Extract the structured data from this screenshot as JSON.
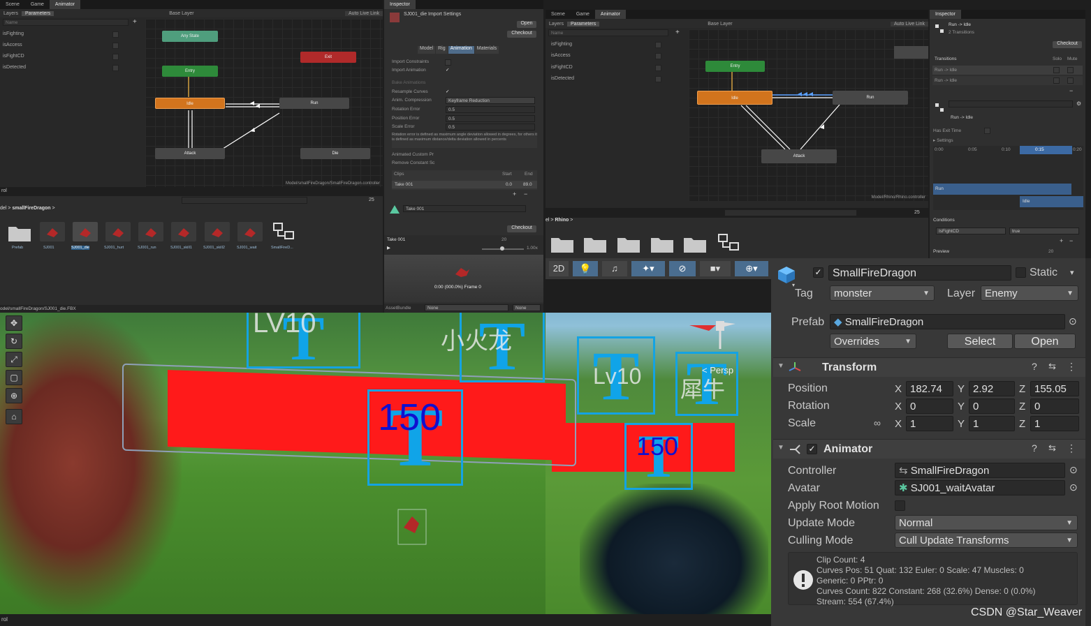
{
  "left_animator": {
    "tabs": [
      "Scene",
      "Game",
      "Animator"
    ],
    "subtabs": [
      "Layers",
      "Parameters"
    ],
    "layer_title": "Base Layer",
    "auto_live_link": "Auto Live Link",
    "search_placeholder": "Name",
    "params": [
      "isFighting",
      "isAccess",
      "isFightCD",
      "isDetected"
    ],
    "states": {
      "any": "Any State",
      "exit": "Exit",
      "entry": "Entry",
      "idle": "Idle",
      "run": "Run",
      "attack": "Attack",
      "die": "Die"
    },
    "controller_path": "Model/smallFireDragon/SmallFireDragon.controller"
  },
  "project": {
    "panel_label": "rol",
    "breadcrumb_prefix": "del",
    "breadcrumb": "smallFireDragon",
    "count": "25",
    "assets": [
      "Prefab",
      "SJ001",
      "SJ001_die",
      "SJ001_hurt",
      "SJ001_run",
      "SJ001_skill1",
      "SJ001_skill2",
      "SJ001_wait",
      "SmallFireD..."
    ],
    "status_path": "odel/smallFireDragon/SJ001_die.FBX"
  },
  "import_inspector": {
    "tab": "Inspector",
    "title": "SJ001_die Import Settings",
    "open_label": "Open",
    "checkout_label": "Checkout",
    "tabs": [
      "Model",
      "Rig",
      "Animation",
      "Materials"
    ],
    "rows": [
      {
        "label": "Import Constraints",
        "value": ""
      },
      {
        "label": "Import Animation",
        "value": "✓"
      },
      {
        "label": "Bake Animations",
        "value": ""
      },
      {
        "label": "Resample Curves",
        "value": "✓"
      },
      {
        "label": "Anim. Compression",
        "value": "Keyframe Reduction"
      },
      {
        "label": "Rotation Error",
        "value": "0.5"
      },
      {
        "label": "Position Error",
        "value": "0.5"
      },
      {
        "label": "Scale Error",
        "value": "0.5"
      }
    ],
    "note": "Rotation error is defined as maximum angle deviation allowed in degrees, for others it is defined as maximum distance/delta deviation allowed in percents",
    "rows2": [
      "Animated Custom Pr",
      "Remove Constant Sc"
    ],
    "clips_header": {
      "name": "Clips",
      "start": "Start",
      "end": "End"
    },
    "clip": {
      "name": "Take 001",
      "start": "0.0",
      "end": "89.0"
    },
    "take_name": "Take 001",
    "checkout2": "Checkout",
    "preview_name": "Take 001",
    "preview_frames": "20",
    "preview_speed": "1.00x",
    "preview_time": "0:00 (000.0%) Frame 0",
    "asset_bundle_label": "AssetBundle",
    "asset_bundle_value": "None",
    "asset_bundle_variant": "None"
  },
  "right_animator": {
    "tabs": [
      "Scene",
      "Game",
      "Animator"
    ],
    "subtabs": [
      "Layers",
      "Parameters"
    ],
    "layer_title": "Base Layer",
    "auto_live_link": "Auto Live Link",
    "search_placeholder": "Name",
    "params": [
      "isFighting",
      "isAccess",
      "isFightCD",
      "isDetected"
    ],
    "states": {
      "entry": "Entry",
      "idle": "Idle",
      "run": "Run",
      "attack": "Attack"
    },
    "controller_path": "Model/Rhino/Rhino.controller",
    "breadcrumb_prefix": "el",
    "breadcrumb": "Rhino",
    "count": "25"
  },
  "transition_inspector": {
    "tab": "Inspector",
    "title": "Run -> Idle",
    "subtitle": "2 Transitions",
    "checkout": "Checkout",
    "transitions_header": "Transitions",
    "solo": "Solo",
    "mute": "Mute",
    "transitions": [
      "Run -> Idle",
      "Run -> Idle"
    ],
    "selected": "Run -> Idle",
    "has_exit_time": "Has Exit Time",
    "settings": "Settings",
    "timeline_ticks": [
      "0:00",
      "0:05",
      "0:10",
      "0:15",
      "0:20"
    ],
    "timeline_run": "Run",
    "timeline_idle": "Idle",
    "conditions": "Conditions",
    "condition_param": "IsFightCD",
    "condition_value": "true",
    "preview": "Preview",
    "preview_count": "20"
  },
  "scene_toolbar": {
    "mode_2d": "2D"
  },
  "scene": {
    "labels": [
      {
        "over": "LV10",
        "big": "T"
      },
      {
        "over": "小火龙",
        "big": "T"
      },
      {
        "over": "150",
        "big": "T"
      },
      {
        "over": "Lv10",
        "big": "T"
      },
      {
        "over": "犀牛",
        "big": "T"
      },
      {
        "over": "150",
        "big": "T"
      }
    ],
    "persp": "< Persp",
    "bottom_label": "rol"
  },
  "object_inspector": {
    "name": "SmallFireDragon",
    "static": "Static",
    "tag_label": "Tag",
    "tag_value": "monster",
    "layer_label": "Layer",
    "layer_value": "Enemy",
    "prefab_label": "Prefab",
    "prefab_value": "SmallFireDragon",
    "overrides": "Overrides",
    "select": "Select",
    "open": "Open",
    "transform": {
      "title": "Transform",
      "position": {
        "label": "Position",
        "x": "182.74",
        "y": "2.92",
        "z": "155.05"
      },
      "rotation": {
        "label": "Rotation",
        "x": "0",
        "y": "0",
        "z": "0"
      },
      "scale": {
        "label": "Scale",
        "x": "1",
        "y": "1",
        "z": "1"
      }
    },
    "animator": {
      "title": "Animator",
      "controller_label": "Controller",
      "controller_value": "SmallFireDragon",
      "avatar_label": "Avatar",
      "avatar_value": "SJ001_waitAvatar",
      "root_motion_label": "Apply Root Motion",
      "update_mode_label": "Update Mode",
      "update_mode_value": "Normal",
      "culling_label": "Culling Mode",
      "culling_value": "Cull Update Transforms",
      "info": [
        "Clip Count: 4",
        "Curves Pos: 51 Quat: 132 Euler: 0 Scale: 47 Muscles: 0",
        "Generic: 0 PPtr: 0",
        "Curves Count: 822 Constant: 268 (32.6%) Dense: 0 (0.0%)",
        "Stream: 554 (67.4%)"
      ]
    }
  },
  "watermark": "CSDN @Star_Weaver",
  "colors": {
    "accent": "#14a3e3",
    "idle_state": "#d2741d",
    "exit_state": "#b02a2a",
    "entry_state": "#2e8a3a",
    "red_bar": "#ff1a1a"
  }
}
